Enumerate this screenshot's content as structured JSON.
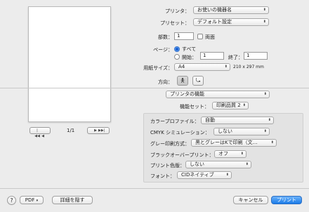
{
  "preview": {
    "page_label": "1/1",
    "nav": {
      "first": "|◀◀",
      "prev": "◀",
      "next": "▶",
      "last": "▶▶|"
    }
  },
  "form": {
    "printer_label": "プリンタ：",
    "printer_value": "お使いの機器名",
    "preset_label": "プリセット：",
    "preset_value": "デフォルト設定",
    "copies_label": "部数：",
    "copies_value": "1",
    "duplex_label": "両面",
    "pages_label": "ページ：",
    "pages_all": "すべて",
    "pages_from_label": "開始：",
    "pages_from_value": "1",
    "pages_to_label": "終了：",
    "pages_to_value": "1",
    "paper_label": "用紙サイズ：",
    "paper_value": "A4",
    "paper_dims": "210 x 297 mm",
    "orientation_label": "方向："
  },
  "section_select": "プリンタの機能",
  "feature_set_label": "機能セット：",
  "feature_set_value": "印刷品質 2",
  "panel": {
    "color_profile_label": "カラープロファイル：",
    "color_profile_value": "自動",
    "cmyk_label": "CMYK シミュレーション：",
    "cmyk_value": "しない",
    "gray_label": "グレー印刷方式：",
    "gray_value": "黒とグレーはKで印刷（文…",
    "overprint_label": "ブラックオーバープリント：",
    "overprint_value": "オフ",
    "print_color_label": "プリント色版：",
    "print_color_value": "しない",
    "font_label": "フォント：",
    "font_value": "CIDネイティブ"
  },
  "footer": {
    "help": "?",
    "pdf": "PDF",
    "hide_details": "詳細を隠す",
    "cancel": "キャンセル",
    "print": "プリント"
  }
}
